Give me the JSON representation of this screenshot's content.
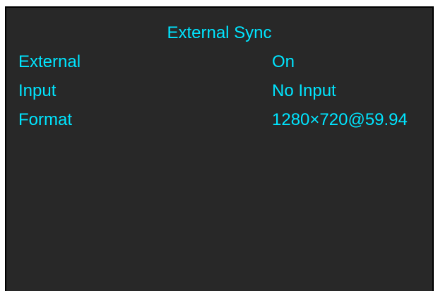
{
  "colors": {
    "background": "#282828",
    "text": "#00e5ff",
    "frame": "#000000"
  },
  "menu": {
    "title": "External Sync",
    "rows": [
      {
        "label": "External",
        "value": "On"
      },
      {
        "label": "Input",
        "value": "No Input"
      },
      {
        "label": "Format",
        "value": "1280×720@59.94"
      }
    ]
  }
}
